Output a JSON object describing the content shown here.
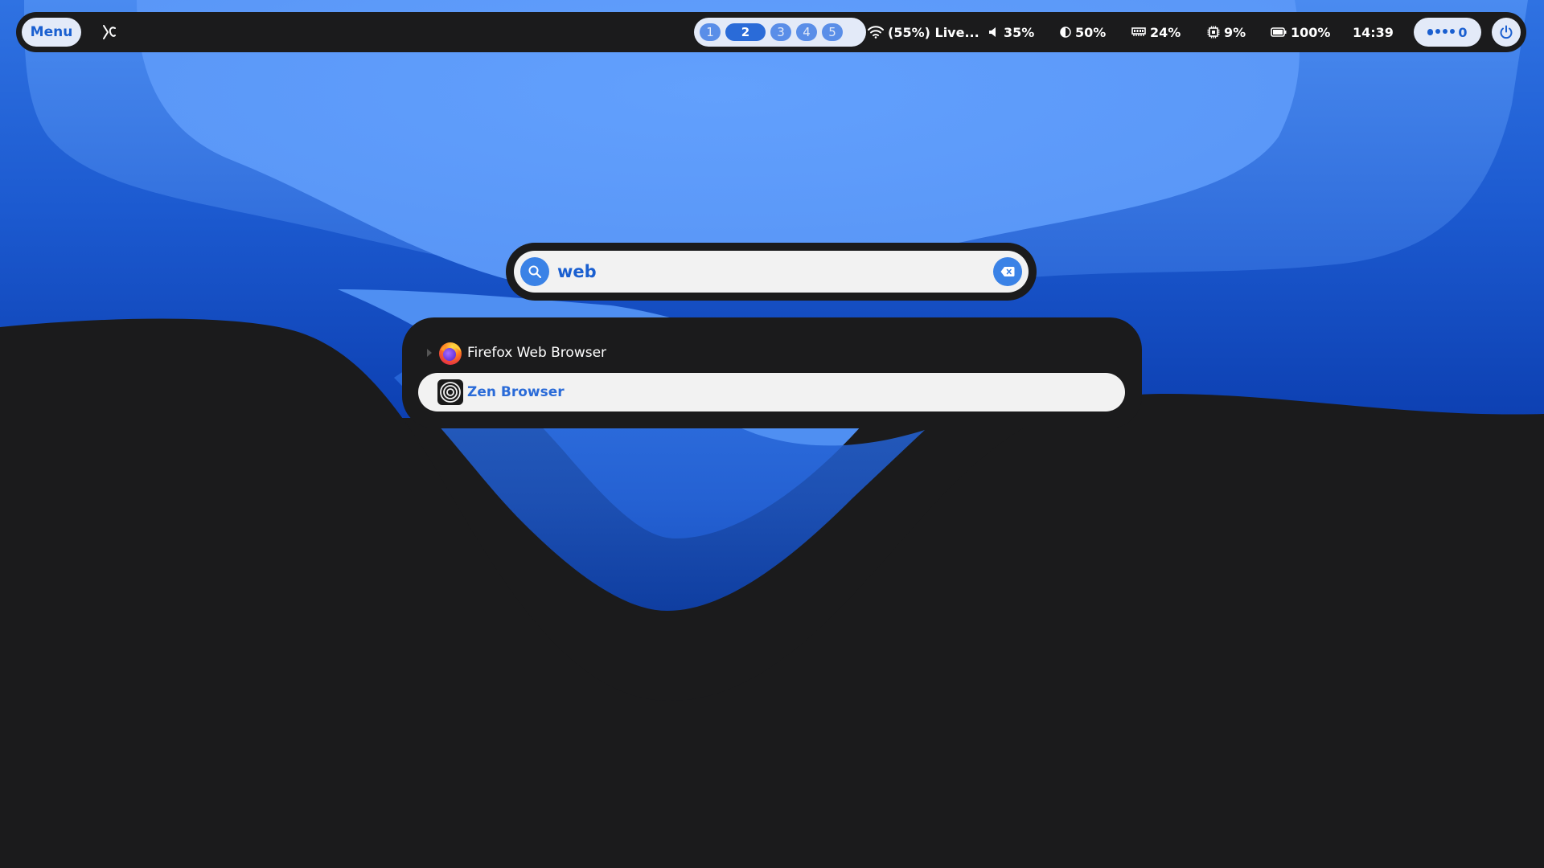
{
  "topbar": {
    "menu_label": "Menu",
    "launcher_icon": "distro-logo-icon",
    "workspaces": [
      "1",
      "2",
      "3",
      "4",
      "5"
    ],
    "active_workspace": "2",
    "wifi_text": "(55%) Live...",
    "volume_text": "35%",
    "brightness_text": "50%",
    "memory_text": "24%",
    "cpu_text": "9%",
    "battery_text": "100%",
    "clock": "14:39",
    "notifications_count": "0"
  },
  "search": {
    "query": "web",
    "placeholder": ""
  },
  "results": [
    {
      "label": "Firefox Web Browser",
      "icon": "firefox-icon",
      "selected": false
    },
    {
      "label": "Zen Browser",
      "icon": "zen-browser-icon",
      "selected": true
    }
  ],
  "colors": {
    "accent": "#2a6bd8",
    "bar_bg": "#1b1b1c",
    "pill_bg": "#e3eaf8",
    "wallpaper_light": "#5c9dfc",
    "wallpaper_mid": "#2c6fdc",
    "wallpaper_dark": "#0c3fb4"
  }
}
